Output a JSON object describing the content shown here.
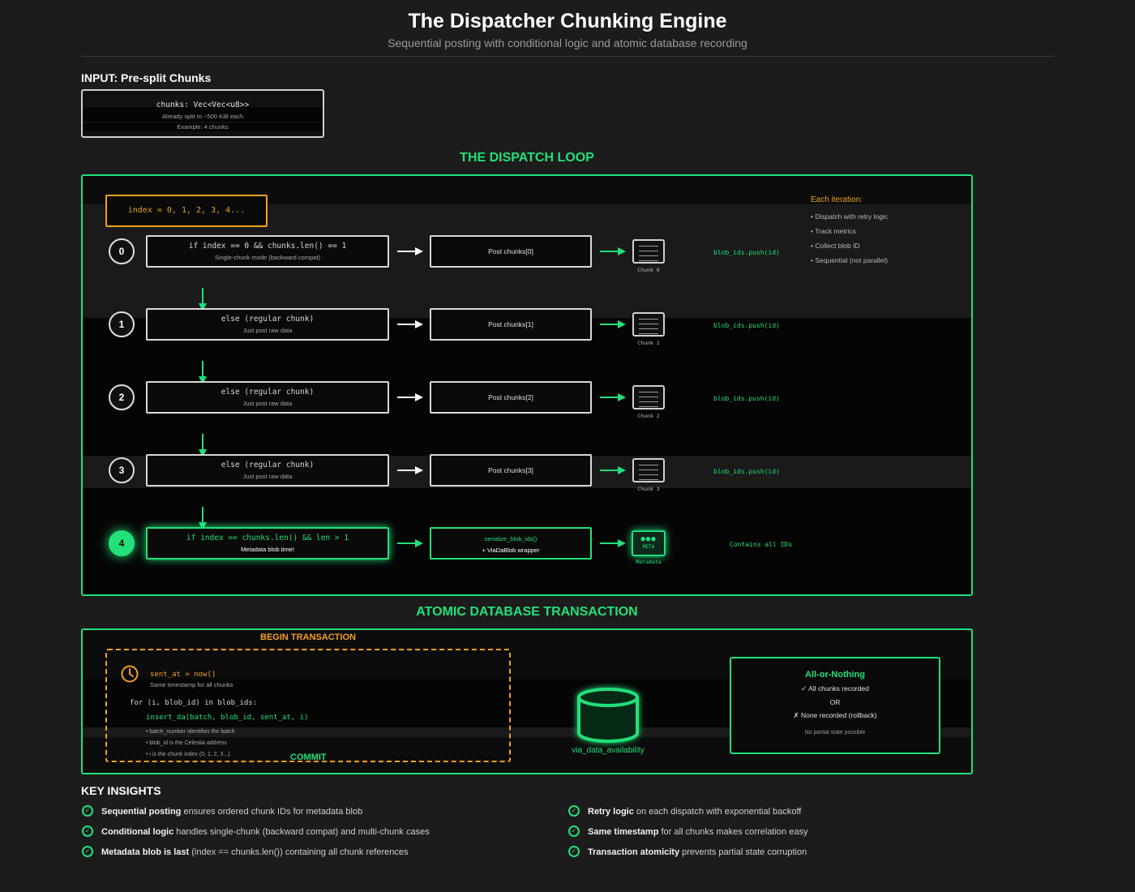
{
  "header": {
    "title": "The Dispatcher Chunking Engine",
    "subtitle": "Sequential posting with conditional logic and atomic database recording"
  },
  "input": {
    "label": "INPUT: Pre-split Chunks",
    "type": "chunks: Vec<Vec<u8>>",
    "note1": "Already split to ~500 KiB each",
    "note2": "Example: 4 chunks"
  },
  "loop": {
    "heading": "THE DISPATCH LOOP",
    "index_label": "index = 0, 1, 2, 3, 4...",
    "rows": [
      {
        "num": "0",
        "cond": "if index == 0 && chunks.len() == 1",
        "cond_note": "Single-chunk mode (backward compat)",
        "post": "Post chunks[0]",
        "chunk_label": "Chunk 0",
        "push": "blob_ids.push(id)"
      },
      {
        "num": "1",
        "cond": "else (regular chunk)",
        "cond_note": "Just post raw data",
        "post": "Post chunks[1]",
        "chunk_label": "Chunk 1",
        "push": "blob_ids.push(id)"
      },
      {
        "num": "2",
        "cond": "else (regular chunk)",
        "cond_note": "Just post raw data",
        "post": "Post chunks[2]",
        "chunk_label": "Chunk 2",
        "push": "blob_ids.push(id)"
      },
      {
        "num": "3",
        "cond": "else (regular chunk)",
        "cond_note": "Just post raw data",
        "post": "Post chunks[3]",
        "chunk_label": "Chunk 3",
        "push": "blob_ids.push(id)"
      }
    ],
    "final_row": {
      "num": "4",
      "cond": "if index == chunks.len() && len > 1",
      "cond_note": "Metadata blob time!",
      "post_line1": "serialize_blob_ids()",
      "post_line2": "+ ViaDaBlob wrapper",
      "meta_icon_text": "META",
      "meta_label": "Metadata",
      "note": "Contains all IDs"
    },
    "each_iteration": {
      "title": "Each iteration:",
      "items": [
        "• Dispatch with retry logic",
        "• Track metrics",
        "• Collect blob ID",
        "• Sequential (not parallel)"
      ]
    }
  },
  "db": {
    "heading": "ATOMIC DATABASE TRANSACTION",
    "begin": "BEGIN TRANSACTION",
    "sent_at": "sent_at = now()",
    "sent_at_note": "Same timestamp for all chunks",
    "for_line": "for (i, blob_id) in blob_ids:",
    "insert_line": "insert_da(batch, blob_id, sent_at, i)",
    "notes": [
      "• batch_number identifies the batch",
      "• blob_id is the Celestia address",
      "• i is the chunk index (0, 1, 2, 3...)"
    ],
    "commit": "COMMIT",
    "db_label": "via_data_availability",
    "all_or_nothing": {
      "title": "All-or-Nothing",
      "line1": "✓ All chunks recorded",
      "or": "OR",
      "line2": "✗ None recorded (rollback)",
      "note": "No partial state possible"
    }
  },
  "insights": {
    "heading": "KEY INSIGHTS",
    "items": [
      {
        "bold": "Sequential posting",
        "text": " ensures ordered chunk IDs for metadata blob"
      },
      {
        "bold": "Conditional logic",
        "text": " handles single-chunk (backward compat) and multi-chunk cases"
      },
      {
        "bold": "Metadata blob is last",
        "text": " (index == chunks.len()) containing all chunk references"
      },
      {
        "bold": "Retry logic",
        "text": " on each dispatch with exponential backoff"
      },
      {
        "bold": "Same timestamp",
        "text": " for all chunks makes correlation easy"
      },
      {
        "bold": "Transaction atomicity",
        "text": " prevents partial state corruption"
      }
    ]
  },
  "colors": {
    "accent": "#22e07a",
    "orange": "#f0a020",
    "background": "#1c1c1c"
  }
}
